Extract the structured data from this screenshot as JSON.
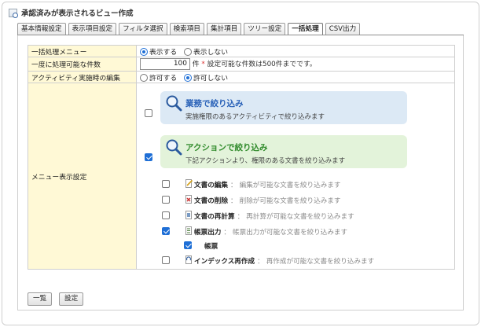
{
  "window": {
    "title": "承認済みが表示されるビュー作成"
  },
  "tabs": [
    {
      "label": "基本情報設定",
      "active": false
    },
    {
      "label": "表示項目設定",
      "active": false
    },
    {
      "label": "フィルタ選択",
      "active": false
    },
    {
      "label": "検索項目",
      "active": false
    },
    {
      "label": "集計項目",
      "active": false
    },
    {
      "label": "ツリー設定",
      "active": false
    },
    {
      "label": "一括処理",
      "active": true
    },
    {
      "label": "CSV出力",
      "active": false
    }
  ],
  "form": {
    "bulk_menu": {
      "label": "一括処理メニュー",
      "options": [
        {
          "label": "表示する",
          "selected": true
        },
        {
          "label": "表示しない",
          "selected": false
        }
      ]
    },
    "max_count": {
      "label": "一度に処理可能な件数",
      "value": "100",
      "unit": "件",
      "required_mark": "*",
      "note": "設定可能な件数は500件までです。"
    },
    "activity_edit": {
      "label": "アクティビティ実施時の編集",
      "options": [
        {
          "label": "許可する",
          "selected": false
        },
        {
          "label": "許可しない",
          "selected": true
        }
      ]
    },
    "menu_display": {
      "label": "メニュー表示設定",
      "business": {
        "title": "業務で絞り込み",
        "desc": "実施権限のあるアクティビティで絞り込みます",
        "checked": false,
        "color": "#2a62b8"
      },
      "action": {
        "title": "アクションで絞り込み",
        "desc": "下記アクションより、権限のある文書を絞り込みます",
        "checked": true,
        "color": "#2f8a2a"
      },
      "separator": "：",
      "sub_items": [
        {
          "label": "文書の編集",
          "desc": "編集が可能な文書を絞り込みます",
          "checked": false,
          "icon": "edit-document-icon"
        },
        {
          "label": "文書の削除",
          "desc": "削除が可能な文書を絞り込みます",
          "checked": false,
          "icon": "delete-document-icon"
        },
        {
          "label": "文書の再計算",
          "desc": "再計算が可能な文書を絞り込みます",
          "checked": false,
          "icon": "recalc-document-icon"
        },
        {
          "label": "帳票出力",
          "desc": "帳票出力が可能な文書を絞り込みます",
          "checked": true,
          "icon": "report-output-icon"
        },
        {
          "label": "インデックス再作成",
          "desc": "再作成が可能な文書を絞り込みます",
          "checked": false,
          "icon": "reindex-icon"
        }
      ],
      "report_child": {
        "label": "帳票",
        "checked": true
      }
    }
  },
  "buttons": {
    "list": "一覧",
    "settings": "設定"
  }
}
